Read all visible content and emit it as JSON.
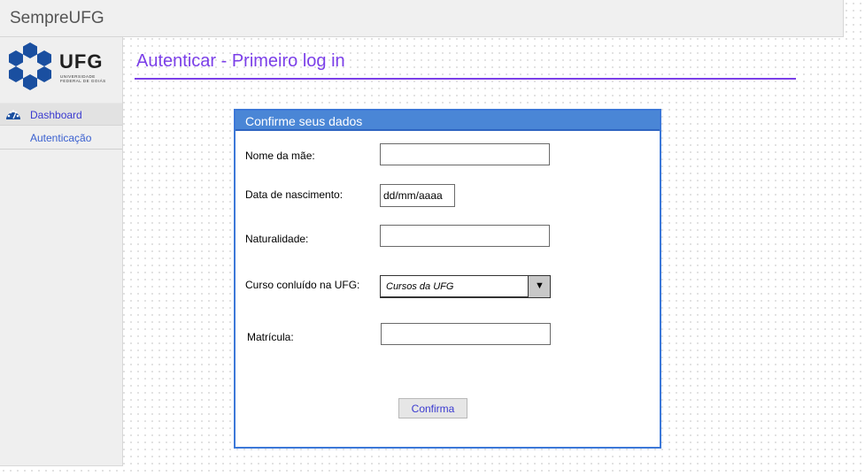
{
  "app": {
    "title": "SempreUFG"
  },
  "logo": {
    "text": "UFG",
    "subtitle": "Universidade Federal de Goiás"
  },
  "sidebar": {
    "items": [
      {
        "label": "Dashboard",
        "icon": "dashboard-icon"
      },
      {
        "label": "Autenticação"
      }
    ]
  },
  "page": {
    "title": "Autenticar - Primeiro log in"
  },
  "form": {
    "header": "Confirme seus dados",
    "fields": {
      "mother_name": {
        "label": "Nome da mãe:",
        "value": ""
      },
      "birth_date": {
        "label": "Data de nascimento:",
        "placeholder": "dd/mm/aaaa"
      },
      "birthplace": {
        "label": "Naturalidade:",
        "value": ""
      },
      "course": {
        "label": "Curso conluído na UFG:",
        "selected": "Cursos da UFG"
      },
      "registration": {
        "label": "Matrícula:",
        "value": ""
      }
    },
    "submit_label": "Confirma"
  },
  "colors": {
    "accent": "#7b3fe8",
    "panel_header": "#4a86d6",
    "panel_border": "#3c78d8",
    "link": "#3a3ad0",
    "logo_blue": "#1a4fa0"
  }
}
